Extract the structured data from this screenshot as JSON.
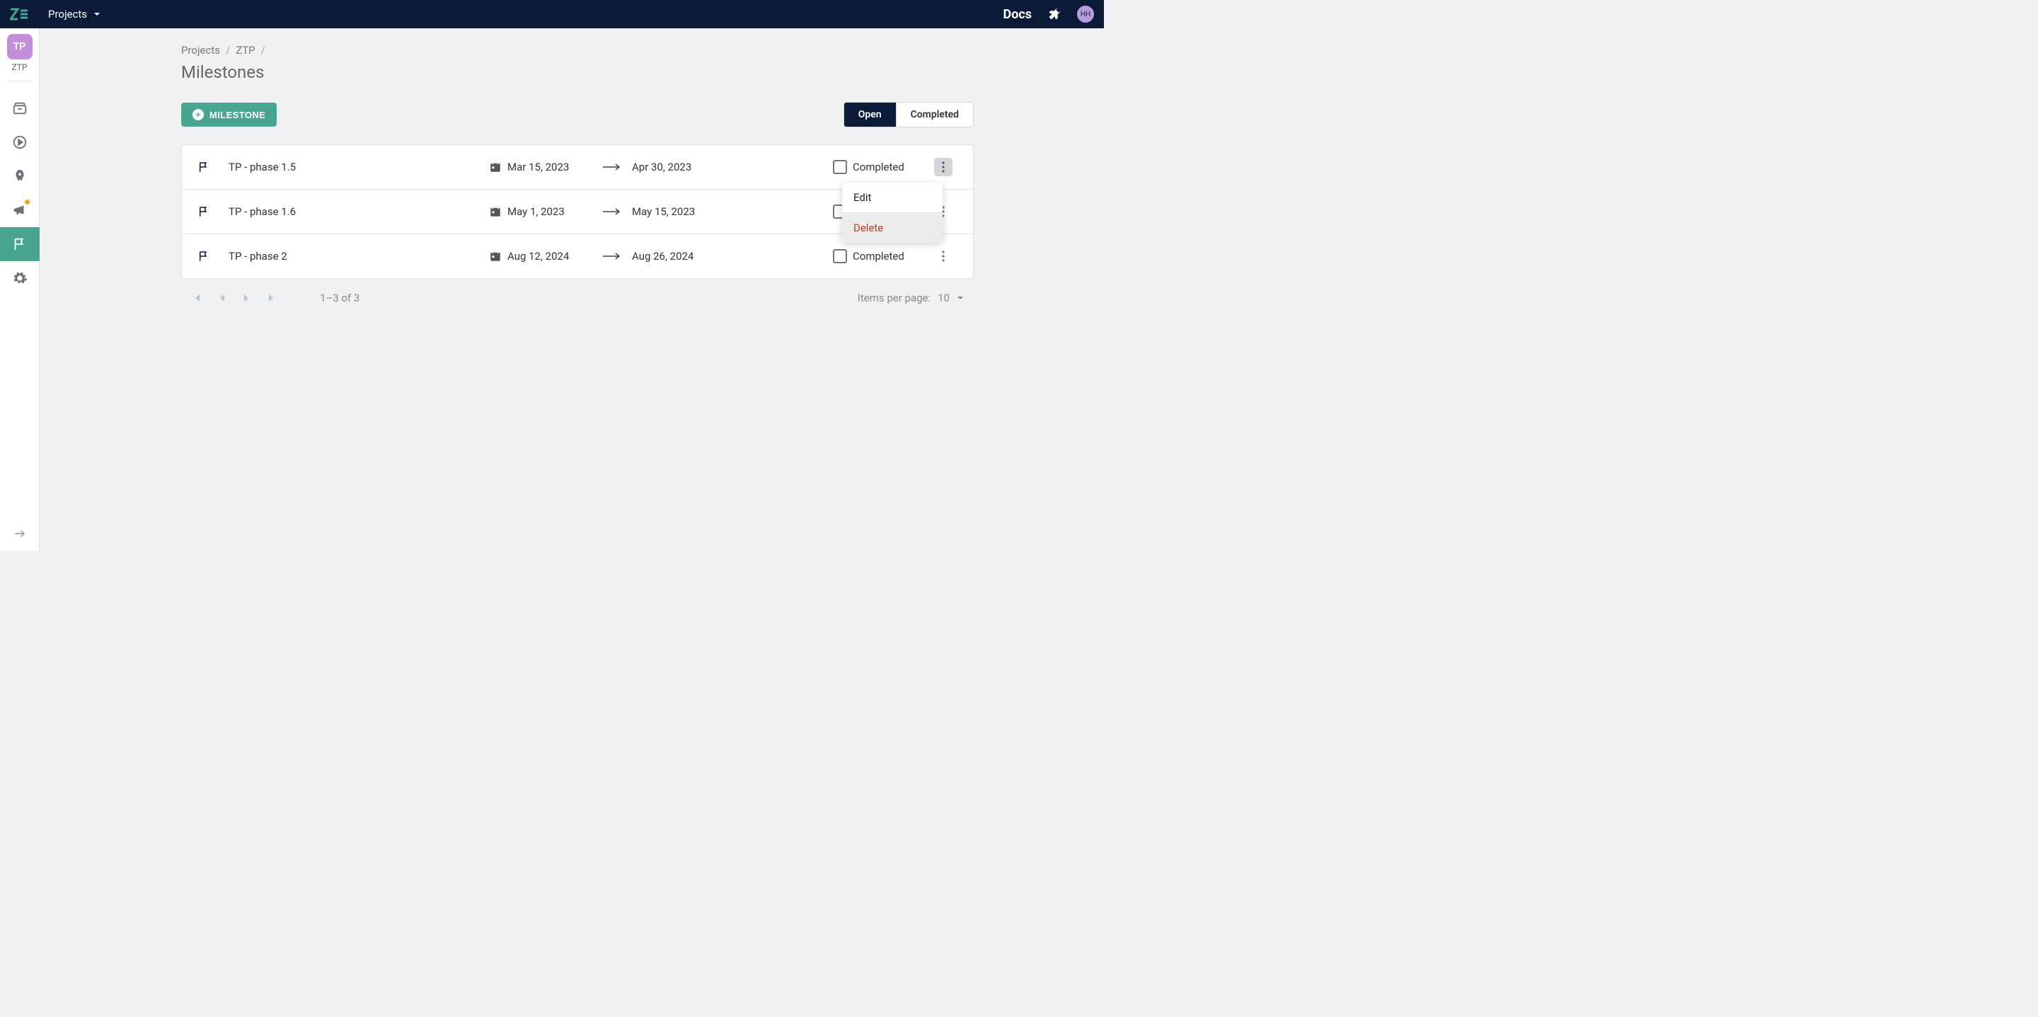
{
  "topbar": {
    "projects_label": "Projects",
    "docs_label": "Docs",
    "avatar_initials": "HH"
  },
  "sidebar": {
    "badge_text": "TP",
    "project_code": "ZTP"
  },
  "breadcrumb": {
    "item1": "Projects",
    "item2": "ZTP"
  },
  "page_title": "Milestones",
  "buttons": {
    "add_milestone": "MILESTONE",
    "tab_open": "Open",
    "tab_completed": "Completed"
  },
  "rows": [
    {
      "name": "TP - phase 1.5",
      "start": "Mar 15, 2023",
      "end": "Apr 30, 2023",
      "status": "Completed"
    },
    {
      "name": "TP - phase 1.6",
      "start": "May 1, 2023",
      "end": "May 15, 2023",
      "status": ""
    },
    {
      "name": "TP - phase 2",
      "start": "Aug 12, 2024",
      "end": "Aug 26, 2024",
      "status": "Completed"
    }
  ],
  "pager": {
    "range": "1–3 of 3",
    "ipp_label": "Items per page:",
    "ipp_value": "10"
  },
  "menu": {
    "edit": "Edit",
    "delete": "Delete"
  }
}
